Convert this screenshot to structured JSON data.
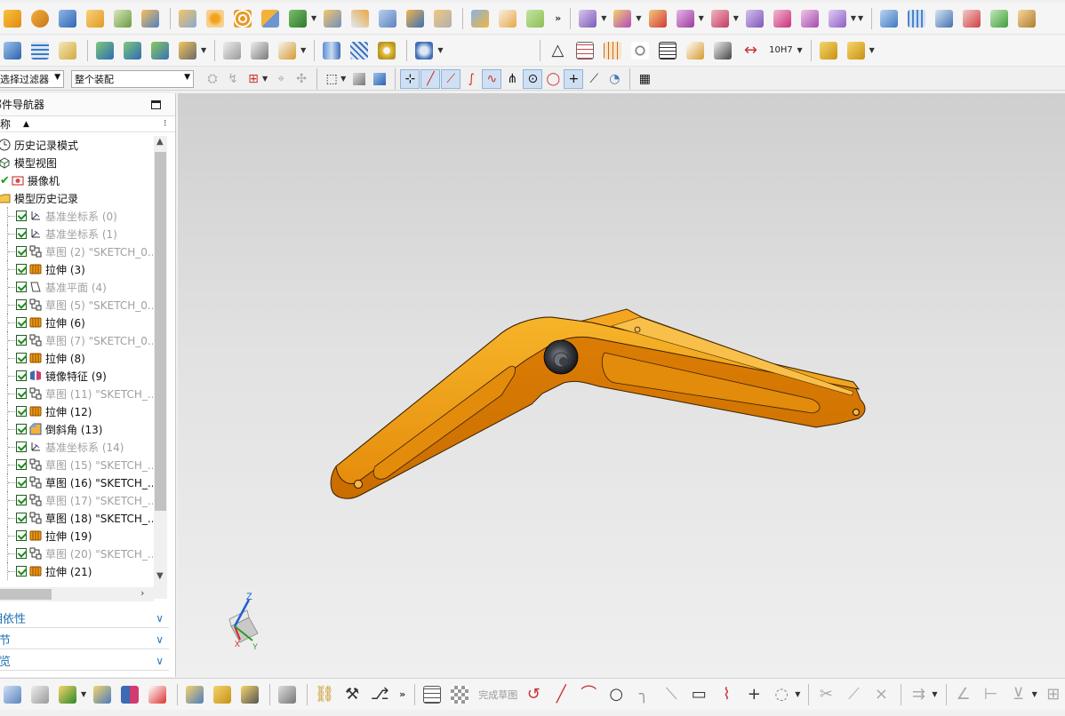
{
  "selection_bar": {
    "filter_value": "选择过滤器",
    "assembly_scope_value": "整个装配"
  },
  "navigator": {
    "title": "部件导航器",
    "column_name": "名称",
    "items": [
      {
        "label": "历史记录模式",
        "icon": "clock-icon",
        "dim": false,
        "checked": false
      },
      {
        "label": "模型视图",
        "icon": "model-views-icon",
        "dim": false,
        "checked": false
      },
      {
        "label": "摄像机",
        "icon": "camera-icon",
        "dim": false,
        "checked": false
      },
      {
        "label": "模型历史记录",
        "icon": "folder-icon",
        "dim": false,
        "checked": false
      },
      {
        "label": "基准坐标系 (0)",
        "icon": "datum-csys-icon",
        "dim": true,
        "checked": true
      },
      {
        "label": "基准坐标系 (1)",
        "icon": "datum-csys-icon",
        "dim": true,
        "checked": true
      },
      {
        "label": "草图 (2) \"SKETCH_0...",
        "icon": "sketch-icon",
        "dim": true,
        "checked": true
      },
      {
        "label": "拉伸 (3)",
        "icon": "extrude-icon",
        "dim": false,
        "checked": true
      },
      {
        "label": "基准平面 (4)",
        "icon": "datum-plane-icon",
        "dim": true,
        "checked": true
      },
      {
        "label": "草图 (5) \"SKETCH_0...",
        "icon": "sketch-icon",
        "dim": true,
        "checked": true
      },
      {
        "label": "拉伸 (6)",
        "icon": "extrude-icon",
        "dim": false,
        "checked": true
      },
      {
        "label": "草图 (7) \"SKETCH_0...",
        "icon": "sketch-icon",
        "dim": true,
        "checked": true
      },
      {
        "label": "拉伸 (8)",
        "icon": "extrude-icon",
        "dim": false,
        "checked": true
      },
      {
        "label": "镜像特征 (9)",
        "icon": "mirror-feature-icon",
        "dim": false,
        "checked": true
      },
      {
        "label": "草图 (11) \"SKETCH_...",
        "icon": "sketch-icon",
        "dim": true,
        "checked": true
      },
      {
        "label": "拉伸 (12)",
        "icon": "extrude-icon",
        "dim": false,
        "checked": true
      },
      {
        "label": "倒斜角 (13)",
        "icon": "chamfer-icon",
        "dim": false,
        "checked": true
      },
      {
        "label": "基准坐标系 (14)",
        "icon": "datum-csys-icon",
        "dim": true,
        "checked": true
      },
      {
        "label": "草图 (15) \"SKETCH_...",
        "icon": "sketch-icon",
        "dim": true,
        "checked": true
      },
      {
        "label": "草图 (16) \"SKETCH_...",
        "icon": "sketch-icon",
        "dim": false,
        "checked": true
      },
      {
        "label": "草图 (17) \"SKETCH_...",
        "icon": "sketch-icon",
        "dim": true,
        "checked": true
      },
      {
        "label": "草图 (18) \"SKETCH_...",
        "icon": "sketch-icon",
        "dim": false,
        "checked": true
      },
      {
        "label": "拉伸 (19)",
        "icon": "extrude-icon",
        "dim": false,
        "checked": true
      },
      {
        "label": "草图 (20) \"SKETCH_...",
        "icon": "sketch-icon",
        "dim": true,
        "checked": true
      },
      {
        "label": "拉伸 (21)",
        "icon": "extrude-icon",
        "dim": false,
        "checked": true
      }
    ],
    "panels": [
      {
        "label": "相依性"
      },
      {
        "label": "细节"
      },
      {
        "label": "预览"
      }
    ]
  },
  "toolbar": {
    "tolerance_label": "10H7"
  },
  "sketch_toolbar": {
    "finish_sketch_label": "完成草图"
  },
  "viewport": {
    "axis_z": "Z",
    "axis_x": "X",
    "axis_y": "Y",
    "part_color": "#f29c16",
    "background_top": "#cfcfcf",
    "background_bottom": "#efefef"
  }
}
